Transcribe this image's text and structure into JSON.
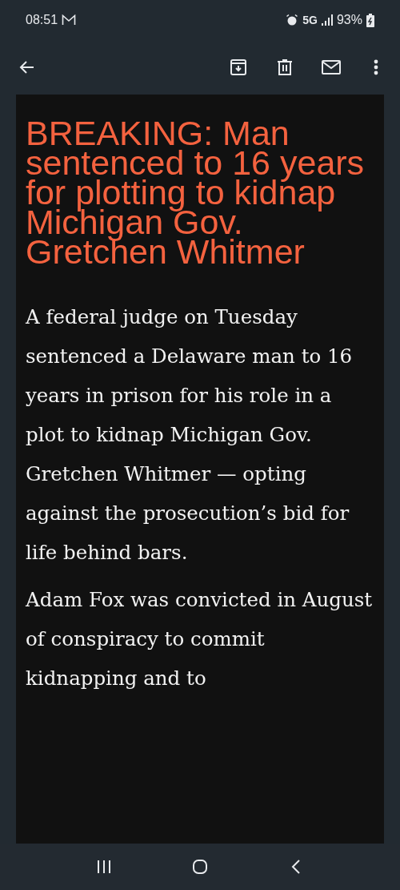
{
  "status_bar": {
    "time": "08:51",
    "network": "5G",
    "battery": "93%"
  },
  "email": {
    "headline": "BREAKING: Man sentenced to 16 years for plotting to kidnap Michigan Gov. Gretchen Whitmer",
    "paragraphs": [
      "A federal judge on Tuesday sentenced a Delaware man to 16 years in prison for his role in a plot to kidnap Michigan Gov. Gretchen Whitmer — opting against the prosecution’s bid for life behind bars.",
      "Adam Fox was convicted in August of conspiracy to commit kidnapping and to"
    ]
  }
}
